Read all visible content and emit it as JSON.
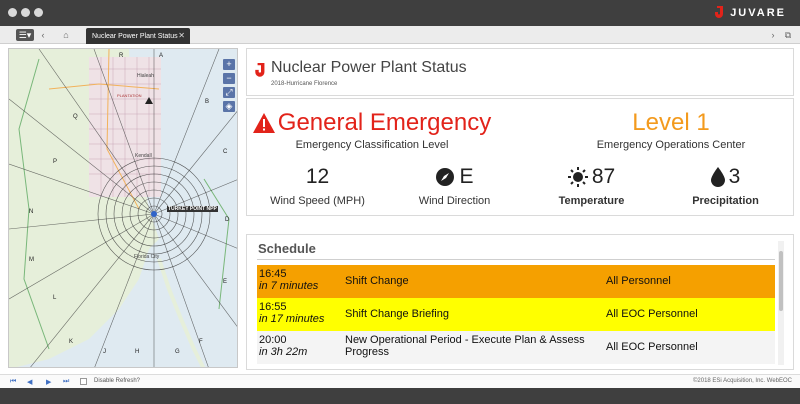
{
  "brand": {
    "name": "JUVARE"
  },
  "tab": {
    "label": "Nuclear Power Plant Status"
  },
  "header": {
    "title": "Nuclear Power Plant Status",
    "subtitle": "2018-Hurricane Florence"
  },
  "status": {
    "classification": {
      "value": "General Emergency",
      "label": "Emergency Classification Level",
      "color": "#e2231a"
    },
    "eoc": {
      "value": "Level 1",
      "label": "Emergency Operations Center",
      "color": "#f39a1d"
    },
    "wind_speed": {
      "value": "12",
      "label": "Wind Speed (MPH)"
    },
    "wind_direction": {
      "value": "E",
      "label": "Wind Direction"
    },
    "temperature": {
      "value": "87",
      "label": "Temperature"
    },
    "precipitation": {
      "value": "3",
      "label": "Precipitation"
    }
  },
  "schedule": {
    "title": "Schedule",
    "rows": [
      {
        "time": "16:45",
        "relative": "in 7 minutes",
        "event": "Shift Change",
        "audience": "All Personnel",
        "color": "#f5a000"
      },
      {
        "time": "16:55",
        "relative": "in 17 minutes",
        "event": "Shift Change Briefing",
        "audience": "All EOC Personnel",
        "color": "#ffff00"
      },
      {
        "time": "20:00",
        "relative": "in 3h 22m",
        "event": "New Operational Period - Execute Plan & Assess Progress",
        "audience": "All EOC Personnel",
        "color": "#f4f4f4"
      }
    ]
  },
  "map": {
    "plant_label": "TURKEY POINT NPP",
    "area_labels": [
      "Hialeah",
      "Kendall",
      "Florida City",
      "PLANTATION"
    ],
    "sector_letters": [
      "A",
      "B",
      "C",
      "D",
      "E",
      "F",
      "G",
      "H",
      "J",
      "K",
      "L",
      "M",
      "N",
      "P",
      "Q",
      "R"
    ]
  },
  "footer": {
    "refresh_label": "Disable Refresh?",
    "copyright": "©2018 ESi Acquisition, Inc. WebEOC"
  }
}
